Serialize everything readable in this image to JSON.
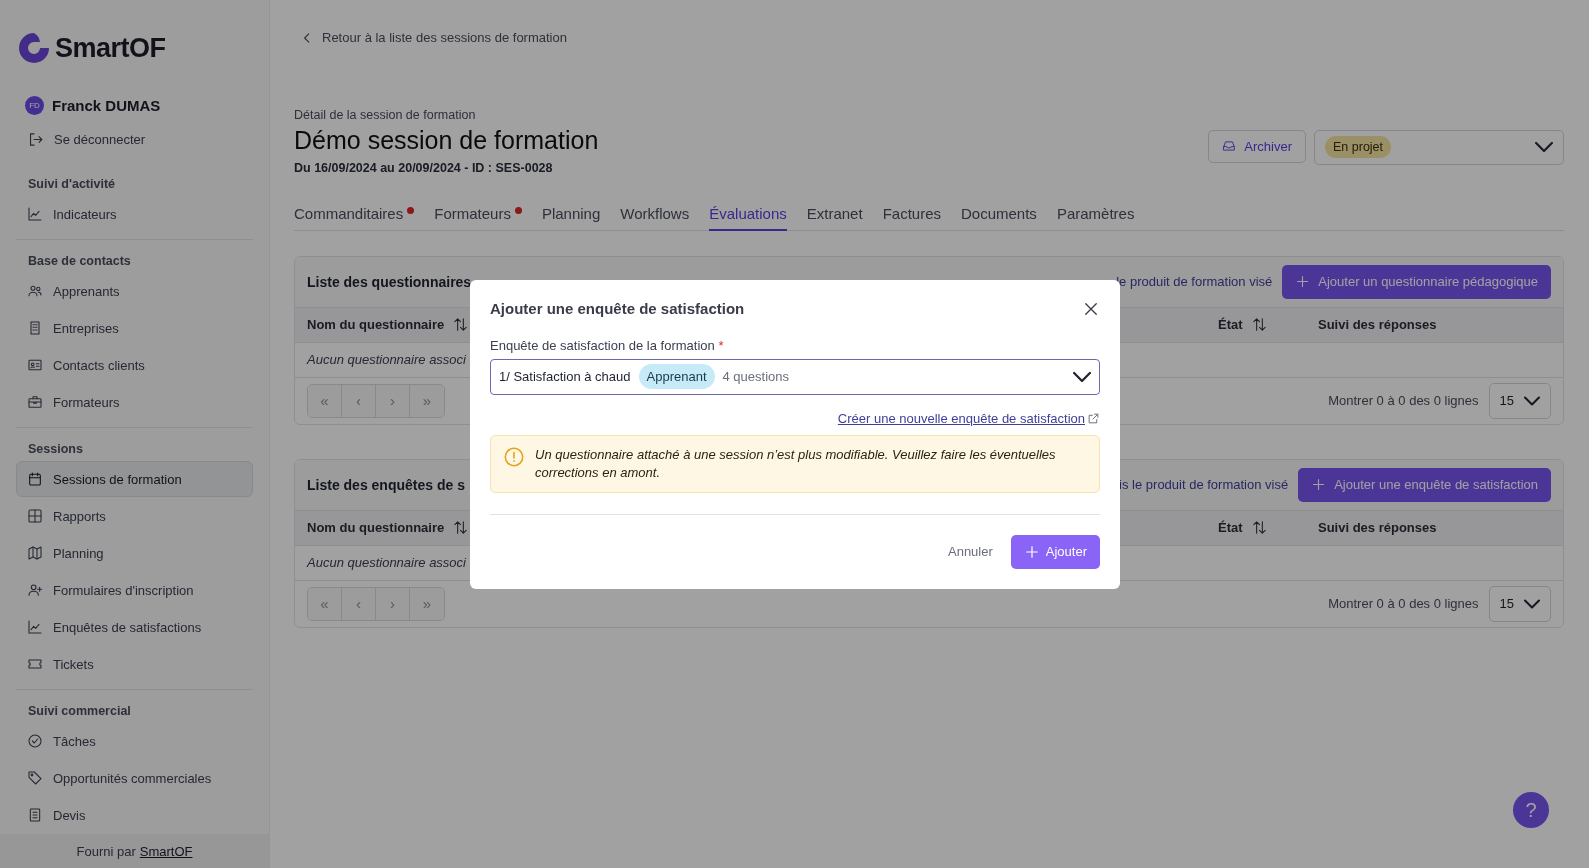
{
  "logo": {
    "text": "SmartOF"
  },
  "user": {
    "initials": "FD",
    "name": "Franck DUMAS"
  },
  "logout": "Se déconnecter",
  "sidebar": {
    "sections": [
      {
        "title": "Suivi d'activité",
        "items": [
          {
            "label": "Indicateurs",
            "kind": "chart",
            "selected": false
          }
        ]
      },
      {
        "title": "Base de contacts",
        "items": [
          {
            "label": "Apprenants",
            "kind": "users",
            "selected": false
          },
          {
            "label": "Entreprises",
            "kind": "building",
            "selected": false
          },
          {
            "label": "Contacts clients",
            "kind": "card",
            "selected": false
          },
          {
            "label": "Formateurs",
            "kind": "briefcase",
            "selected": false
          }
        ]
      },
      {
        "title": "Sessions",
        "items": [
          {
            "label": "Sessions de formation",
            "kind": "calendar",
            "selected": true
          },
          {
            "label": "Rapports",
            "kind": "grid",
            "selected": false
          },
          {
            "label": "Planning",
            "kind": "map",
            "selected": false
          },
          {
            "label": "Formulaires d'inscription",
            "kind": "userplus",
            "selected": false
          },
          {
            "label": "Enquêtes de satisfactions",
            "kind": "chart",
            "selected": false
          },
          {
            "label": "Tickets",
            "kind": "ticket",
            "selected": false
          }
        ]
      },
      {
        "title": "Suivi commercial",
        "items": [
          {
            "label": "Tâches",
            "kind": "check",
            "selected": false
          },
          {
            "label": "Opportunités commerciales",
            "kind": "tag",
            "selected": false
          },
          {
            "label": "Devis",
            "kind": "document",
            "selected": false
          }
        ]
      }
    ]
  },
  "footer": {
    "prefix": "Fourni par",
    "link": "SmartOF"
  },
  "back_link": "Retour à la liste des sessions de formation",
  "page": {
    "subtitle": "Détail de la session de formation",
    "title": "Démo session de formation",
    "meta": "Du 16/09/2024 au 20/09/2024 - ID : SES-0028"
  },
  "archive_button": "Archiver",
  "status_select": {
    "value": "En projet"
  },
  "tabs": [
    {
      "label": "Commanditaires",
      "alert": true,
      "selected": false
    },
    {
      "label": "Formateurs",
      "alert": true,
      "selected": false
    },
    {
      "label": "Planning",
      "alert": false,
      "selected": false
    },
    {
      "label": "Workflows",
      "alert": false,
      "selected": false
    },
    {
      "label": "Évaluations",
      "alert": false,
      "selected": true
    },
    {
      "label": "Extranet",
      "alert": false,
      "selected": false
    },
    {
      "label": "Factures",
      "alert": false,
      "selected": false
    },
    {
      "label": "Documents",
      "alert": false,
      "selected": false
    },
    {
      "label": "Paramètres",
      "alert": false,
      "selected": false
    }
  ],
  "panels": [
    {
      "title": "Liste des questionnaires",
      "filter_text": "le produit de formation visé",
      "add_button": "Ajouter un questionnaire pédagogique",
      "columns": [
        {
          "label": "Nom du questionnaire",
          "sortable": true
        },
        {
          "label": "État",
          "sortable": true
        },
        {
          "label": "Suivi des réponses",
          "sortable": false
        }
      ],
      "empty_text": "Aucun questionnaire associ",
      "pager": [
        "«",
        "‹",
        "›",
        "»"
      ],
      "range": "Montrer 0 à 0 des 0 lignes",
      "page_size": "15"
    },
    {
      "title": "Liste des enquêtes de s",
      "filter_text": "is le produit de formation visé",
      "add_button": "Ajouter une enquête de satisfaction",
      "columns": [
        {
          "label": "Nom du questionnaire",
          "sortable": true
        },
        {
          "label": "État",
          "sortable": true
        },
        {
          "label": "Suivi des réponses",
          "sortable": false
        }
      ],
      "empty_text": "Aucun questionnaire associ",
      "pager": [
        "«",
        "‹",
        "›",
        "»"
      ],
      "range": "Montrer 0 à 0 des 0 lignes",
      "page_size": "15"
    }
  ],
  "modal": {
    "title": "Ajouter une enquête de satisfaction",
    "field_label": "Enquête de satisfaction de la formation",
    "required_mark": "*",
    "select": {
      "value": "1/ Satisfaction à chaud",
      "tag": "Apprenant",
      "count": "4 questions"
    },
    "create_link": "Créer une nouvelle enquête de satisfaction",
    "warning": "Un questionnaire attaché à une session n’est plus modifiable. Veuillez faire les éventuelles corrections en amont.",
    "cancel_button": "Annuler",
    "submit_button": "Ajouter"
  },
  "help_button": "?"
}
